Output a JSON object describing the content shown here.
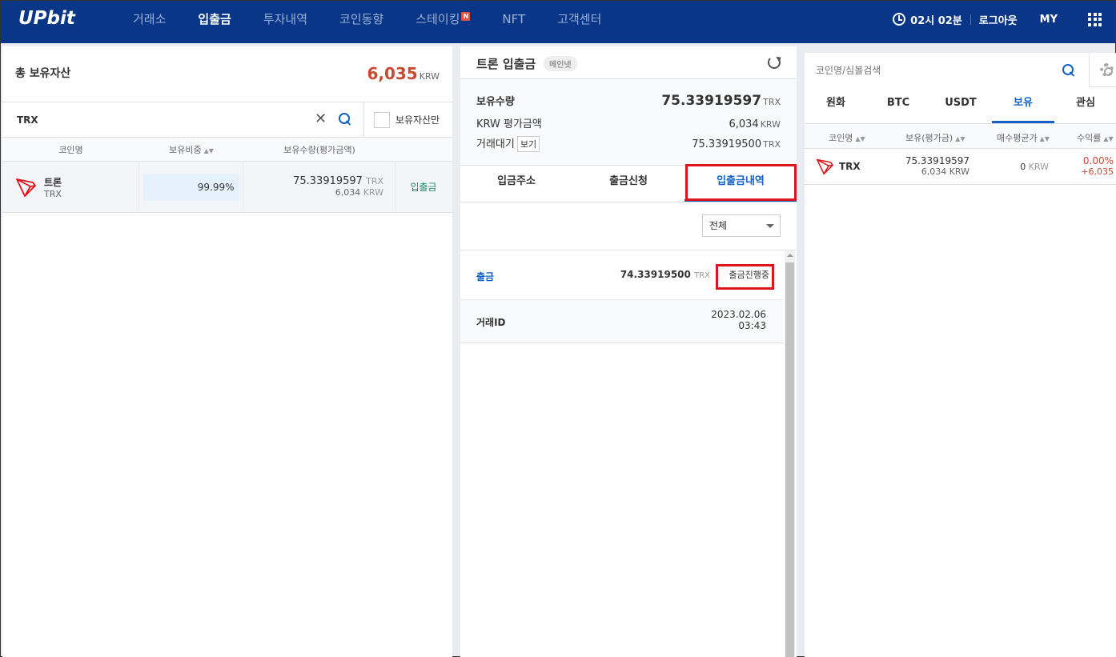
{
  "header": {
    "logo": "UPbit",
    "nav": [
      {
        "label": "거래소",
        "active": false
      },
      {
        "label": "입출금",
        "active": true
      },
      {
        "label": "투자내역",
        "active": false
      },
      {
        "label": "코인동향",
        "active": false
      },
      {
        "label": "스테이킹",
        "active": false,
        "badge": "N"
      },
      {
        "label": "NFT",
        "active": false
      },
      {
        "label": "고객센터",
        "active": false
      }
    ],
    "time": "02시 02분",
    "logout": "로그아웃",
    "my": "MY"
  },
  "left": {
    "total_title": "총 보유자산",
    "total_value": "6,035",
    "total_unit": "KRW",
    "search_value": "TRX",
    "only_held_label": "보유자산만",
    "columns": [
      "코인명",
      "보유비중",
      "보유수량(평가금액)"
    ],
    "row": {
      "name": "트론",
      "symbol": "TRX",
      "ratio": "99.99%",
      "amount": "75.33919597",
      "amount_unit": "TRX",
      "krw_value": "6,034",
      "krw_unit": "KRW",
      "action": "입출금"
    }
  },
  "mid": {
    "title": "트론 입출금",
    "network": "메인넷",
    "balance": {
      "held_label": "보유수량",
      "held_value": "75.33919597",
      "held_unit": "TRX",
      "krw_label": "KRW 평가금액",
      "krw_value": "6,034",
      "krw_unit": "KRW",
      "pending_label": "거래대기",
      "view_label": "보기",
      "pending_value": "75.33919500",
      "pending_unit": "TRX"
    },
    "tabs": [
      "입금주소",
      "출금신청",
      "입출금내역"
    ],
    "active_tab": "입출금내역",
    "filter_value": "전체",
    "history": {
      "type": "출금",
      "amount": "74.33919500",
      "amount_unit": "TRX",
      "status": "출금진행중",
      "id_label": "거래ID",
      "date": "2023.02.06",
      "time": "03:43"
    }
  },
  "right": {
    "search_placeholder": "코인명/심볼검색",
    "tabs": [
      "원화",
      "BTC",
      "USDT",
      "보유",
      "관심"
    ],
    "active_tab": "보유",
    "columns": [
      "코인명",
      "보유(평가금)",
      "매수평균가",
      "수익률"
    ],
    "row": {
      "symbol": "TRX",
      "amount": "75.33919597",
      "krw_value": "6,034",
      "krw_unit": "KRW",
      "avg_price": "0",
      "avg_unit": "KRW",
      "profit_rate": "0.00%",
      "profit_amount": "+6,035"
    }
  },
  "colors": {
    "header_bg": "#093687",
    "accent_blue": "#1261c4",
    "price_red": "#c84a31",
    "highlight_red": "#e0141c"
  }
}
